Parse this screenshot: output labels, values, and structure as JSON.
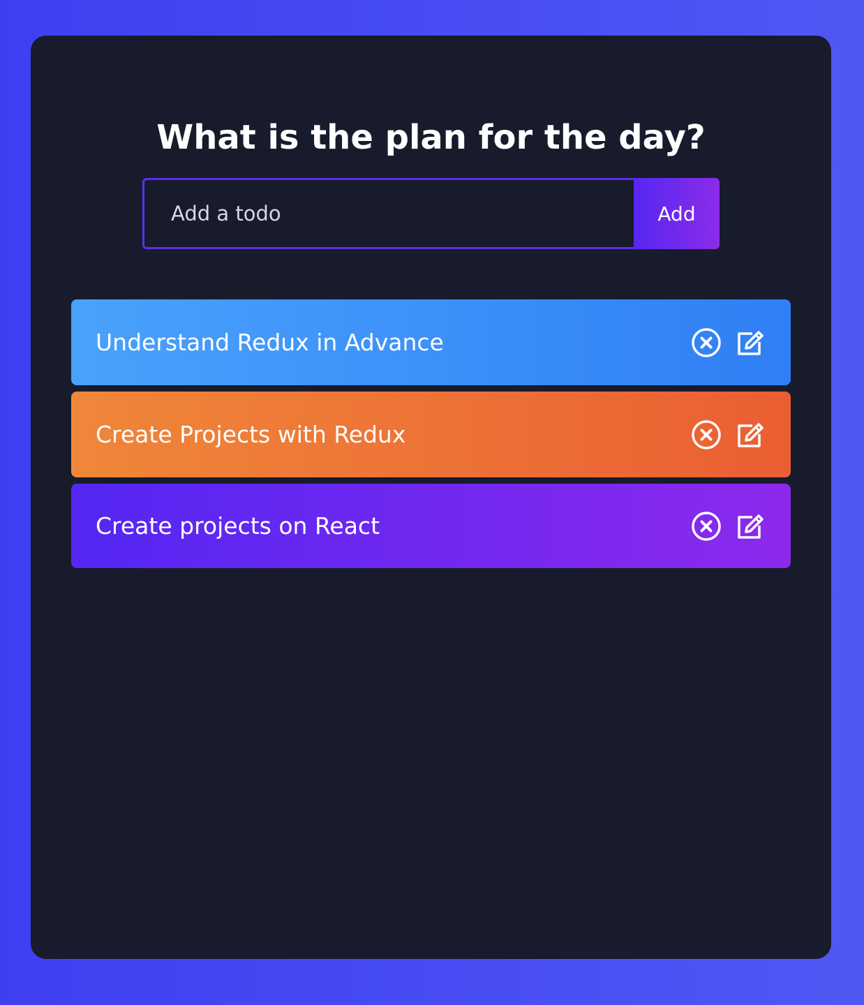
{
  "header": {
    "title": "What is the plan for the day?"
  },
  "form": {
    "input_placeholder": "Add a todo",
    "input_value": "",
    "add_label": "Add"
  },
  "todos": [
    {
      "text": "Understand Redux in Advance",
      "color": "#3f8ff8"
    },
    {
      "text": "Create Projects with Redux",
      "color": "#ed7237"
    },
    {
      "text": "Create projects on React",
      "color": "#6e28f0"
    }
  ],
  "icons": {
    "delete": "close-circle-icon",
    "edit": "edit-pencil-icon"
  },
  "colors": {
    "background": "#4648f3",
    "panel": "#181b2b",
    "accent": "#5a2ef0"
  }
}
